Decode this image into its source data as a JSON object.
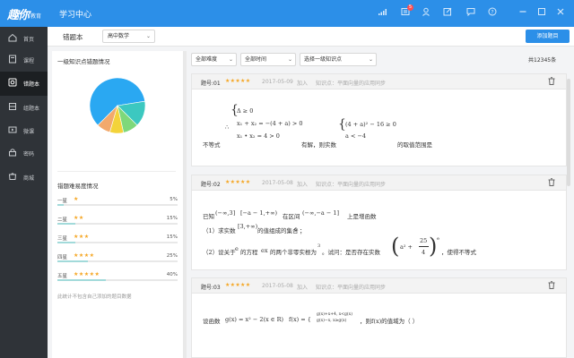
{
  "topbar": {
    "logo": "趣你",
    "logo_sub": "教育",
    "title": "学习中心",
    "badge_count": "5",
    "icons": [
      "signal-icon",
      "message-icon",
      "user-icon",
      "edit-icon",
      "comment-icon",
      "help-icon",
      "minimize-icon",
      "restore-icon",
      "close-icon"
    ]
  },
  "sidebar": {
    "items": [
      {
        "label": "首页",
        "icon": "home-icon",
        "active": false
      },
      {
        "label": "课程",
        "icon": "course-icon",
        "active": false
      },
      {
        "label": "错题本",
        "icon": "wrongbook-icon",
        "active": true
      },
      {
        "label": "组题本",
        "icon": "group-icon",
        "active": false
      },
      {
        "label": "微课",
        "icon": "microcourse-icon",
        "active": false
      },
      {
        "label": "密码",
        "icon": "password-icon",
        "active": false
      },
      {
        "label": "商城",
        "icon": "shop-icon",
        "active": false
      }
    ]
  },
  "header": {
    "title": "错题本",
    "subject": "高中数学",
    "add_button": "添加题目"
  },
  "stats": {
    "knowledge_title": "一级知识点错题情况",
    "pie": [
      {
        "value": 60,
        "color": "#2aa8f2"
      },
      {
        "value": 15,
        "color": "#3cc8c0"
      },
      {
        "value": 9,
        "color": "#7ed87a"
      },
      {
        "value": 8,
        "color": "#f3d33a"
      },
      {
        "value": 8,
        "color": "#f2a96c"
      }
    ],
    "difficulty_title": "错题难易度情况",
    "difficulty": [
      {
        "label": "一星",
        "stars": "★",
        "pct": "5%",
        "value": 5
      },
      {
        "label": "二星",
        "stars": "★★",
        "pct": "15%",
        "value": 15
      },
      {
        "label": "三星",
        "stars": "★★★",
        "pct": "15%",
        "value": 15
      },
      {
        "label": "四星",
        "stars": "★★★★",
        "pct": "25%",
        "value": 25
      },
      {
        "label": "五星",
        "stars": "★★★★★",
        "pct": "40%",
        "value": 40
      }
    ],
    "note": "此统计不包含自己添加的题目数据"
  },
  "filters": {
    "difficulty": "全部难度",
    "time": "全部时间",
    "knowledge": "选择一级知识点",
    "total": "共12345条"
  },
  "questions": [
    {
      "no": "题号:01",
      "stars": "★★★★★",
      "date": "2017-05-09",
      "join": "加入",
      "kp": "知识点：平面向量的应用同步",
      "pre": "不等式",
      "mid": "有解，则实数",
      "post": "的取值范围是",
      "sys1": "Δ ≥ 0",
      "sys2": "x₁ + x₂ = −(4 + a) > 0",
      "sys3": "x₁ • x₂ = 4 > 0",
      "ineq1": "(4 + a)² − 16 ≥ 0",
      "ineq2": "a < −4",
      "therefore": "∴"
    },
    {
      "no": "题号:02",
      "stars": "★★★★★",
      "date": "2017-05-08",
      "join": "加入",
      "kp": "知识点：平面向量的应用同步",
      "l1a": "已知",
      "l1b": "(−∞,3]",
      "l1c": "[−a − 1,+∞)",
      "l1d": "在区间",
      "l1e": "(−∞,−a − 1]",
      "l1f": "上是增函数",
      "l2a": "（1）求实数",
      "l2b": "[3,+∞)",
      "l2c": "的值组成的集合",
      "l2d": "e",
      "l2e": "；",
      "l3a": "（2）设关于",
      "l3b": "e",
      "l3c": "的方程",
      "l3d": "ex",
      "l3e": "的两个非零实根为",
      "l3f": "3",
      "l3g": "。试问：是否存在实数",
      "l3h": "a² + ",
      "l3i": "25",
      "l3j": "4",
      "l3k": "e",
      "l3l": "，使得不等式"
    },
    {
      "no": "题号:03",
      "stars": "★★★★★",
      "date": "2017-05-08",
      "join": "加入",
      "kp": "知识点：平面向量的应用同步",
      "a": "设函数",
      "b": "g(x) = x² − 2(x ∈ R)",
      "c": "f(x) = {",
      "c1": "g(x)+x+4, x<g(x)",
      "c2": "g(x)−x, x≥g(x)",
      "d": "，则f(x)的值域为（  ）"
    }
  ]
}
